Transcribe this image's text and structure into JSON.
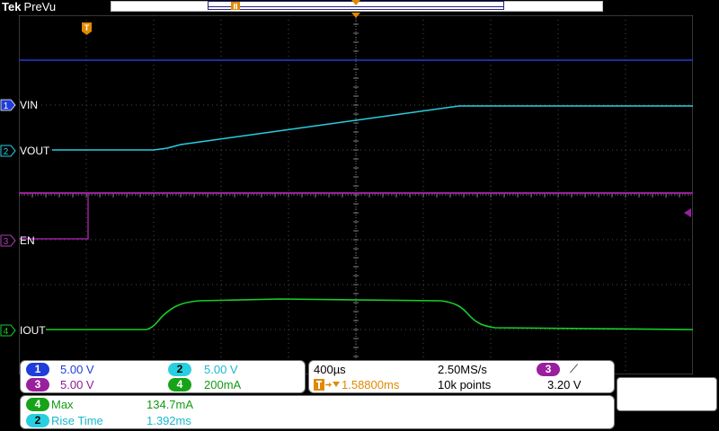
{
  "brand": {
    "name": "Tek",
    "mode": "PreVu"
  },
  "channels": {
    "ch1": {
      "number": "1",
      "name": "VIN",
      "scale": "5.00 V",
      "color": "#1f3ddb"
    },
    "ch2": {
      "number": "2",
      "name": "VOUT",
      "scale": "5.00 V",
      "color": "#27cfe0"
    },
    "ch3": {
      "number": "3",
      "name": "EN",
      "scale": "5.00 V",
      "color": "#9a1f9e"
    },
    "ch4": {
      "number": "4",
      "name": "IOUT",
      "scale": "200mA",
      "color": "#17a317"
    }
  },
  "timebase": {
    "scale": "400µs",
    "sample_rate": "2.50MS/s",
    "trigger_delay": "1.58800ms",
    "record_length": "10k points",
    "trigger_source": "3",
    "trigger_slope": "⟋",
    "trigger_level": "3.20 V"
  },
  "measurements": [
    {
      "channel": "4",
      "name": "Max",
      "value": "134.7mA"
    },
    {
      "channel": "2",
      "name": "Rise Time",
      "value": "1.392ms"
    }
  ],
  "marker_labels": {
    "trigger": "T"
  },
  "colors": {
    "graticule": "#6d6d6d",
    "background": "#000000",
    "trigger_orange": "#e08a00"
  }
}
